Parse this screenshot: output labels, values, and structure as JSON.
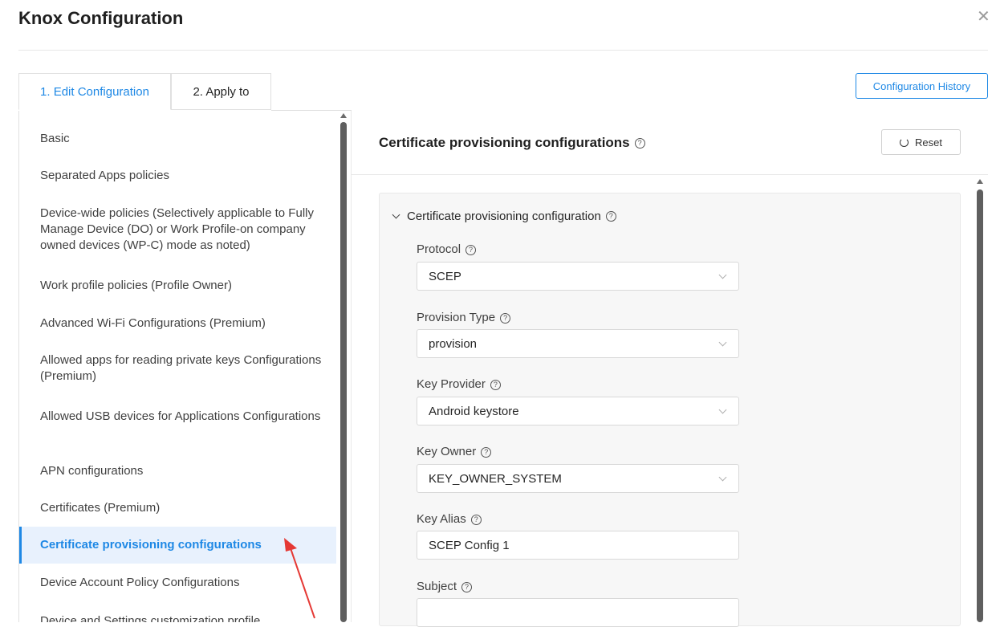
{
  "header": {
    "title": "Knox Configuration"
  },
  "tabs": [
    {
      "label": "1. Edit Configuration"
    },
    {
      "label": "2. Apply to"
    }
  ],
  "history_button": "Configuration History",
  "sidebar": {
    "items": [
      "Basic",
      "Separated Apps policies",
      "Device-wide policies (Selectively applicable to Fully Manage Device (DO) or Work Profile-on company owned devices (WP-C) mode as noted)",
      "Work profile policies (Profile Owner)",
      "Advanced Wi-Fi Configurations (Premium)",
      "Allowed apps for reading private keys Configurations (Premium)",
      "Allowed USB devices for Applications Configurations",
      "APN configurations",
      "Certificates (Premium)",
      "Certificate provisioning configurations",
      "Device Account Policy Configurations",
      "Device and Settings customization profile"
    ],
    "active_index": 9
  },
  "panel": {
    "title": "Certificate provisioning configurations",
    "reset_label": "Reset",
    "section_title": "Certificate provisioning configuration",
    "fields": {
      "protocol": {
        "label": "Protocol",
        "value": "SCEP"
      },
      "provision_type": {
        "label": "Provision Type",
        "value": "provision"
      },
      "key_provider": {
        "label": "Key Provider",
        "value": "Android keystore"
      },
      "key_owner": {
        "label": "Key Owner",
        "value": "KEY_OWNER_SYSTEM"
      },
      "key_alias": {
        "label": "Key Alias",
        "value": "SCEP Config 1"
      },
      "subject": {
        "label": "Subject",
        "value": ""
      }
    }
  },
  "colors": {
    "accent": "#1e88e5",
    "active_bg": "#e8f1fd",
    "annotation_arrow": "#e53935"
  },
  "icons": [
    "close-icon",
    "help-icon",
    "reset-icon",
    "chevron-down-icon",
    "annotation-arrow-icon"
  ]
}
